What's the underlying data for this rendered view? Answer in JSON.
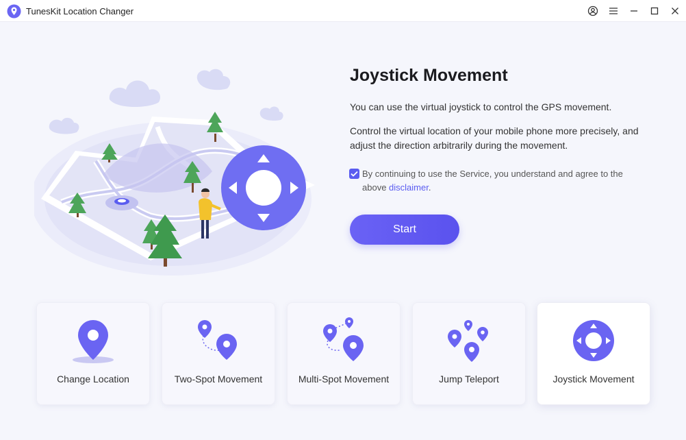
{
  "window": {
    "title": "TunesKit Location Changer",
    "controls": [
      "account-icon",
      "menu-icon",
      "minimize-icon",
      "maximize-icon",
      "close-icon"
    ]
  },
  "feature": {
    "title": "Joystick Movement",
    "description_1": "You can use the virtual joystick to control the GPS movement.",
    "description_2": "Control the virtual location of your mobile phone more precisely, and adjust the direction arbitrarily during the movement.",
    "agreement_text": "By continuing to use the Service, you understand and agree to the above ",
    "agreement_link": "disclaimer",
    "agreement_end": ".",
    "agreement_checked": true,
    "start_label": "Start"
  },
  "modes": [
    {
      "label": "Change Location",
      "icon": "location-pin-icon",
      "active": false
    },
    {
      "label": "Two-Spot Movement",
      "icon": "two-spot-icon",
      "active": false
    },
    {
      "label": "Multi-Spot Movement",
      "icon": "multi-spot-icon",
      "active": false
    },
    {
      "label": "Jump Teleport",
      "icon": "jump-teleport-icon",
      "active": false
    },
    {
      "label": "Joystick Movement",
      "icon": "joystick-icon",
      "active": true
    }
  ],
  "colors": {
    "accent": "#5a5cf0",
    "background": "#f5f6fc"
  }
}
